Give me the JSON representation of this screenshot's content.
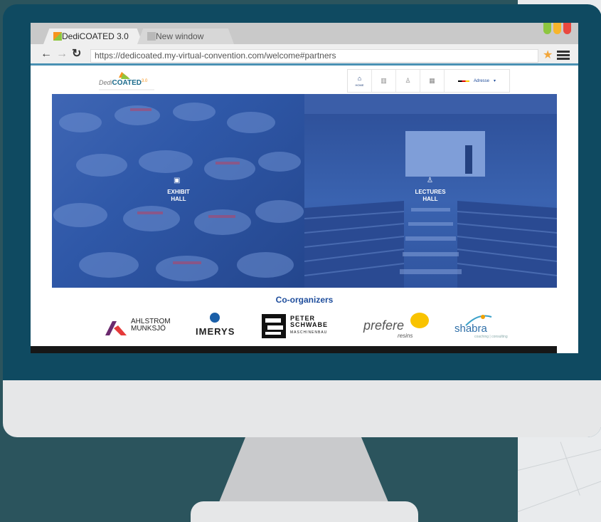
{
  "browser": {
    "tabs": [
      {
        "label": "DediCOATED 3.0",
        "active": true
      },
      {
        "label": "New window",
        "active": false
      }
    ],
    "url": "https://dedicoated.my-virtual-convention.com/welcome#partners",
    "window_dots": [
      "#8dc63f",
      "#f7b52c",
      "#e9483f"
    ]
  },
  "site": {
    "logo": {
      "prefix": "Dedi",
      "brand": "COATED",
      "version": "3.0"
    },
    "nav": {
      "items": [
        {
          "icon": "home-icon",
          "label": "HOME",
          "active": true
        },
        {
          "icon": "exhibit-icon",
          "label": ""
        },
        {
          "icon": "speaker-icon",
          "label": ""
        },
        {
          "icon": "booth-icon",
          "label": ""
        }
      ],
      "language": "Adresse"
    },
    "hero": {
      "left": {
        "label_line1": "EXHIBIT",
        "label_line2": "HALL",
        "icon": "box-icon"
      },
      "right": {
        "label_line1": "LECTURES",
        "label_line2": "HALL",
        "icon": "speaker-icon"
      }
    },
    "organizers": {
      "title": "Co-organizers",
      "partners": [
        {
          "name": "AHLSTROM",
          "subname": "MUNKSJÖ"
        },
        {
          "name": "IMERYS",
          "subname": ""
        },
        {
          "name": "PETER",
          "subname": "SCHWABE",
          "tag": "MASCHINENBAU"
        },
        {
          "name": "prefere",
          "subname": "resins"
        },
        {
          "name": "shabra",
          "subname": "coaching | consulting"
        }
      ]
    }
  },
  "colors": {
    "monitor": "#0f4a61",
    "background": "#2b545d",
    "accent_blue": "#1e4d9c"
  }
}
